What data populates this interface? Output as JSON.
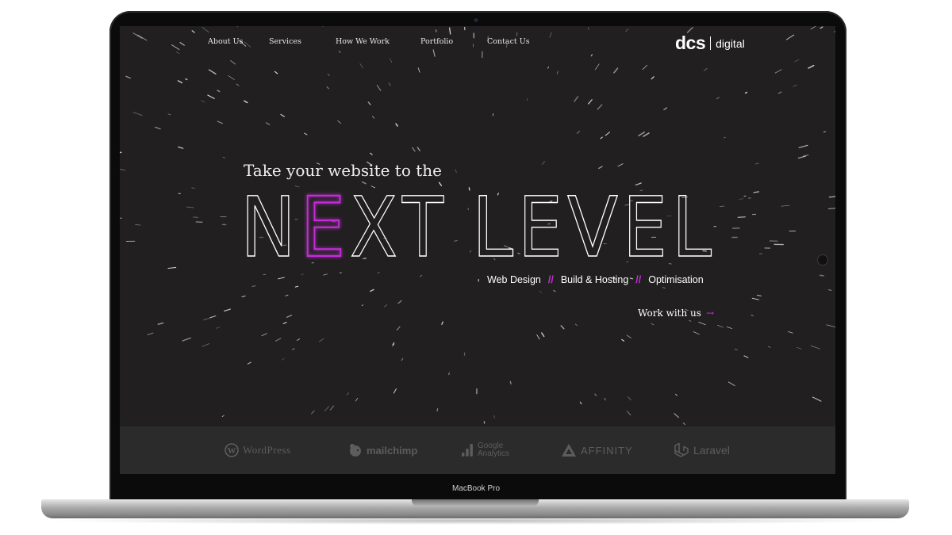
{
  "nav": {
    "items": [
      "About Us",
      "Services",
      "How We Work",
      "Portfolio",
      "Contact Us"
    ]
  },
  "logo": {
    "main": "dcs",
    "sub": "digital"
  },
  "hero": {
    "subtitle": "Take your website to the",
    "title_letters": [
      "N",
      "E",
      "X",
      "T",
      " ",
      "L",
      "E",
      "V",
      "E",
      "L"
    ],
    "highlighted_letter_index": 1,
    "services": [
      "Web Design",
      "Build & Hosting",
      "Optimisation"
    ],
    "service_separator": "//",
    "cta_label": "Work with us",
    "cta_arrow": "→"
  },
  "partners": [
    {
      "name": "WordPress",
      "text": "WordPress",
      "icon": "wordpress-icon"
    },
    {
      "name": "Mailchimp",
      "text": "mailchimp",
      "icon": "mailchimp-icon"
    },
    {
      "name": "Google Analytics",
      "text_line1": "Google",
      "text_line2": "Analytics",
      "icon": "analytics-bars-icon"
    },
    {
      "name": "Affinity",
      "text": "AFFINITY",
      "icon": "affinity-triangle-icon"
    },
    {
      "name": "Laravel",
      "text": "Laravel",
      "icon": "laravel-icon"
    }
  ],
  "device_label": "MacBook Pro",
  "colors": {
    "background": "#211f20",
    "accent": "#c22fd6",
    "text": "#ffffff",
    "partner_band": "#2b2b2c",
    "partner_text": "#5d5d5e"
  }
}
